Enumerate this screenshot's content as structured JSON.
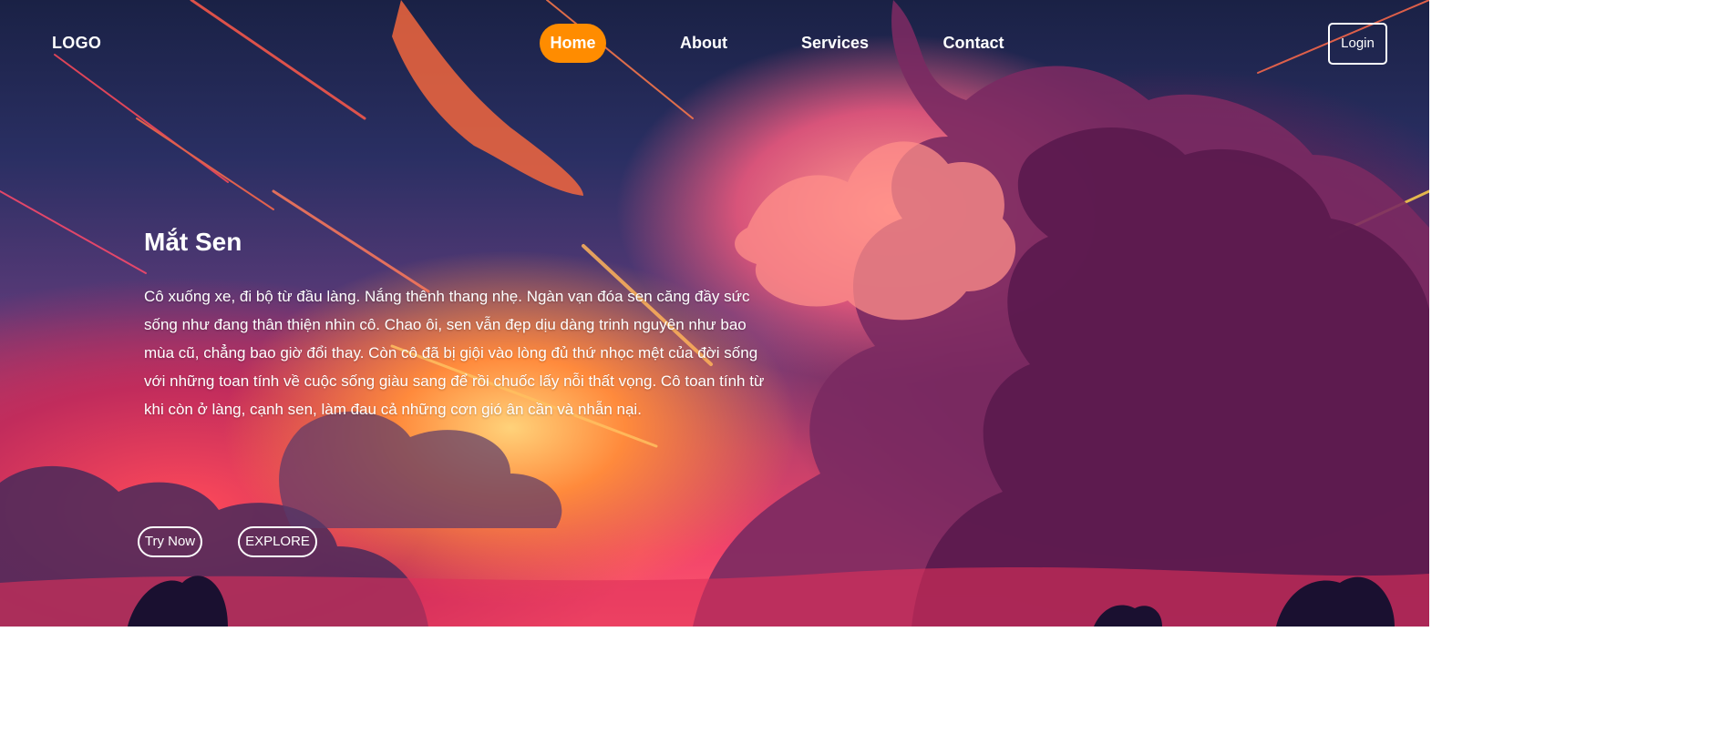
{
  "nav": {
    "logo": "LOGO",
    "items": [
      {
        "label": "Home",
        "active": true
      },
      {
        "label": "About",
        "active": false
      },
      {
        "label": "Services",
        "active": false
      },
      {
        "label": "Contact",
        "active": false
      }
    ],
    "login_label": "Login"
  },
  "hero": {
    "title": "Mắt Sen",
    "body": "Cô xuống xe, đi bộ từ đầu làng. Nắng thênh thang nhẹ. Ngàn vạn đóa sen căng đầy sức sống như đang thân thiện nhìn cô. Chao ôi, sen vẫn đẹp dịu dàng trinh nguyên như bao mùa cũ, chẳng bao giờ đổi thay. Còn cô đã bị giội vào lòng đủ thứ nhọc mệt của đời sống với những toan tính về cuộc sống giàu sang để rồi chuốc lấy nỗi thất vọng. Cô toan tính từ khi còn ở làng, cạnh sen, làm đau cả những cơn gió ân cần và nhẫn nại.",
    "try_label": "Try Now",
    "explore_label": "EXPLORE"
  },
  "colors": {
    "accent": "#ff8c00",
    "text": "#ffffff"
  }
}
